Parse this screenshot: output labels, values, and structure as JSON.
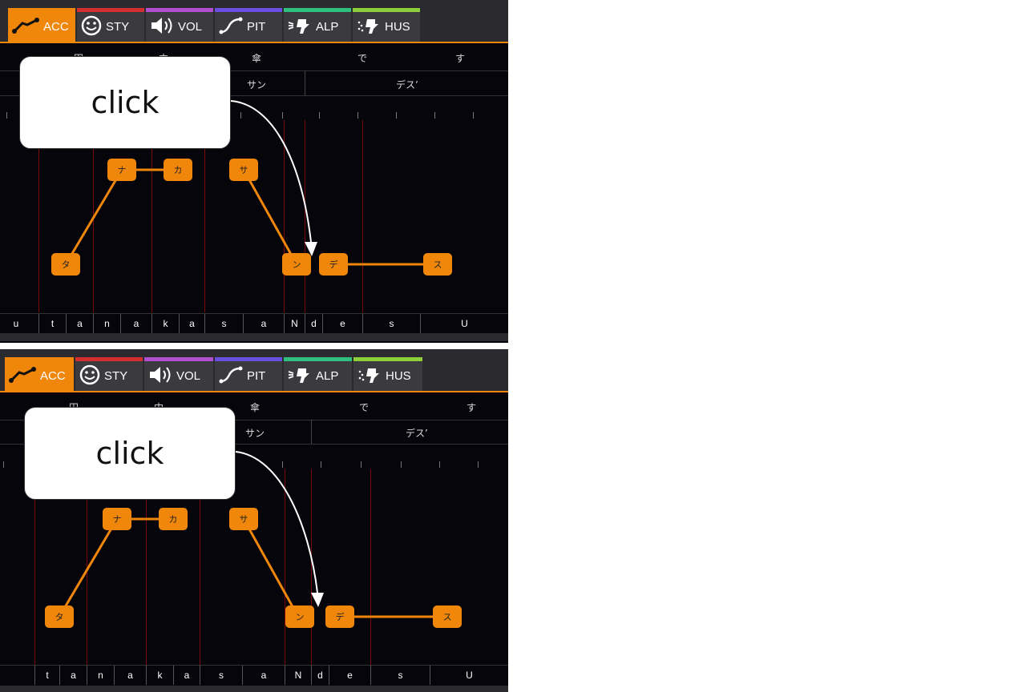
{
  "tabs": [
    {
      "label": "ACC",
      "color": "#f0870a"
    },
    {
      "label": "STY",
      "color": "#d32f2f"
    },
    {
      "label": "VOL",
      "color": "#b04fd0"
    },
    {
      "label": "PIT",
      "color": "#6b4fe0"
    },
    {
      "label": "ALP",
      "color": "#2fbf7f"
    },
    {
      "label": "HUS",
      "color": "#8ccf3a"
    }
  ],
  "lyrics": [
    "田",
    "中",
    "傘",
    "で",
    "す"
  ],
  "kana_groups": [
    "サン",
    "デス’"
  ],
  "nodes": [
    "タ",
    "ナ",
    "カ",
    "サ",
    "ン",
    "デ",
    "ス"
  ],
  "phonemes": [
    "u",
    "t",
    "a",
    "n",
    "a",
    "k",
    "a",
    "s",
    "a",
    "N",
    "d",
    "e",
    "s",
    "U"
  ],
  "callout": {
    "label": "click"
  },
  "colors": {
    "accent": "#f0870a",
    "background": "#05050b",
    "boundary": "#7a0a0a"
  }
}
